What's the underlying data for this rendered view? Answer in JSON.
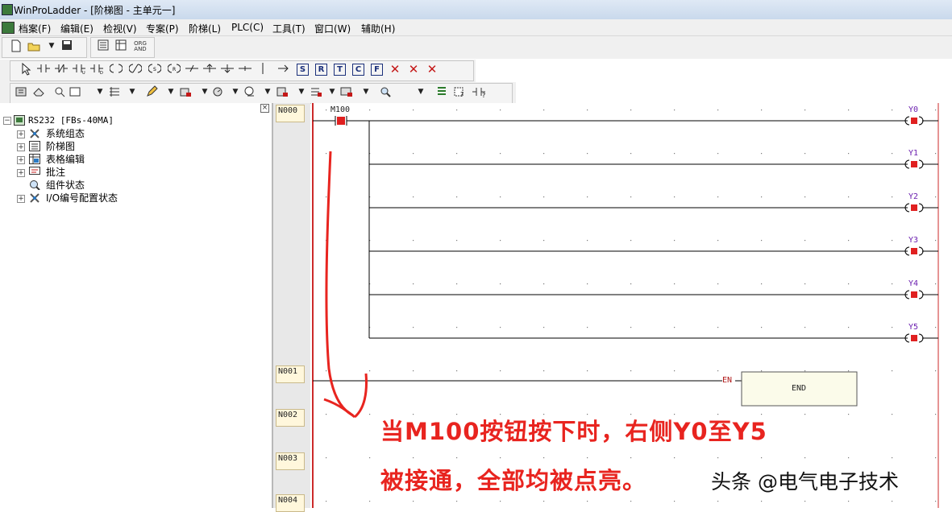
{
  "window": {
    "title": "WinProLadder - [阶梯图 - 主单元一]"
  },
  "menu": [
    "档案(F)",
    "编辑(E)",
    "检视(V)",
    "专案(P)",
    "阶梯(L)",
    "PLC(C)",
    "工具(T)",
    "窗口(W)",
    "辅助(H)"
  ],
  "toolbar": {
    "org_and_label": "ORG AND",
    "box_buttons": [
      "S",
      "R",
      "T",
      "C",
      "F"
    ]
  },
  "tree": {
    "root": "RS232 [FBs-40MA]",
    "items": [
      "系统组态",
      "阶梯图",
      "表格编辑",
      "批注",
      "组件状态",
      "I/O编号配置状态"
    ],
    "expander_plus": "+",
    "expander_minus": "−"
  },
  "networks": [
    "N000",
    "N001",
    "N002",
    "N003",
    "N004"
  ],
  "ladder": {
    "contact": "M100",
    "coils": [
      "Y0",
      "Y1",
      "Y2",
      "Y3",
      "Y4",
      "Y5"
    ],
    "en_label": "EN",
    "end_label": "END"
  },
  "colors": {
    "rail": "#cc2a2a",
    "annotation": "#e8241f",
    "coil_label": "#6b1faf",
    "element_fill": "#e02020"
  },
  "annotation": {
    "line1": "当M100按钮按下时，右侧Y0至Y5",
    "line2": "被接通，全部均被点亮。"
  },
  "watermark": "头条 @电气电子技术"
}
